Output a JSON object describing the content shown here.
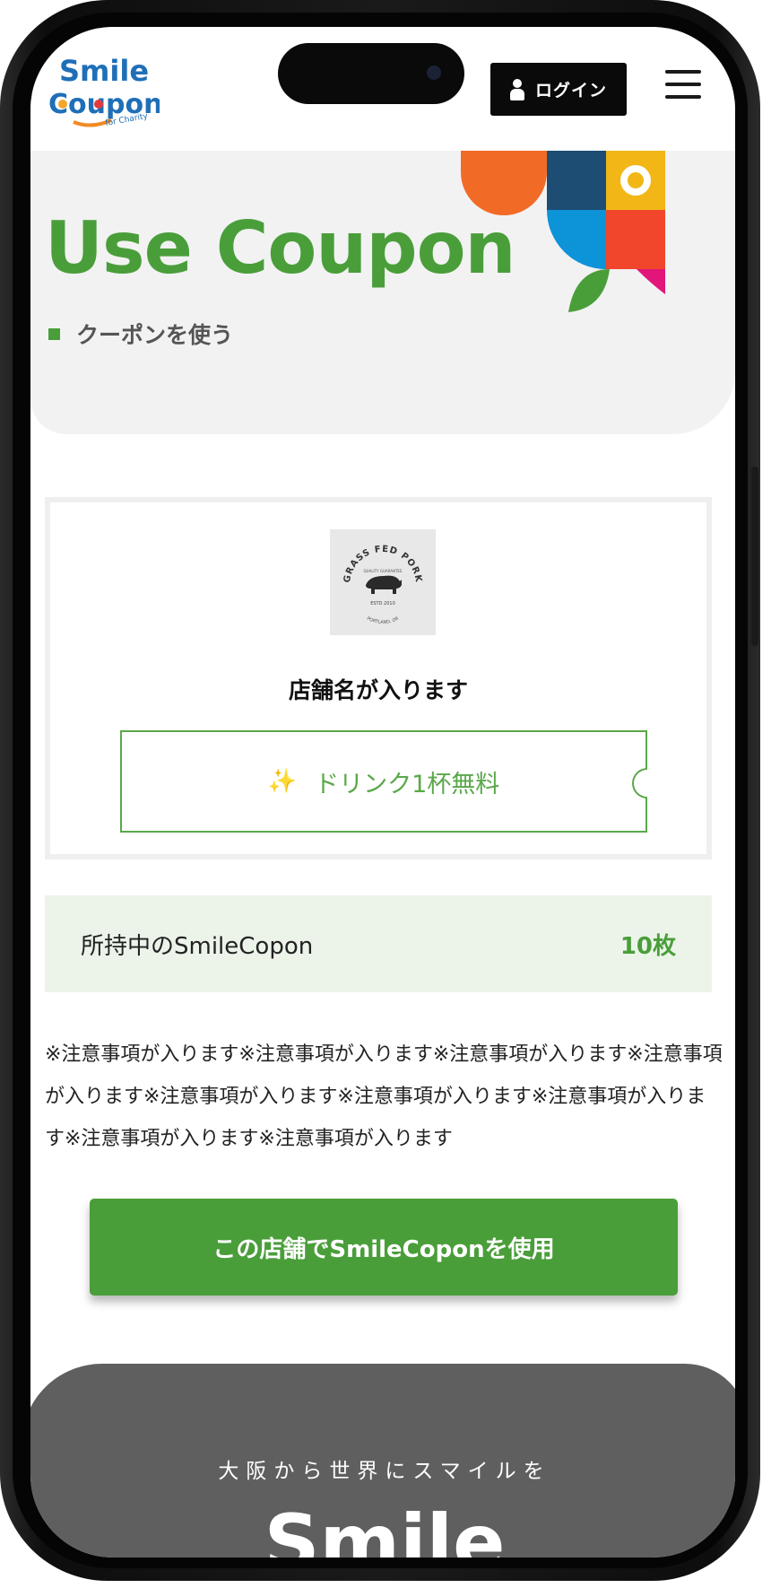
{
  "header": {
    "logo_text_top": "Smile",
    "logo_text_bottom": "Coupon",
    "logo_tagline": "for Charity",
    "login_label": "ログイン",
    "menu_icon": "hamburger-menu-icon"
  },
  "hero": {
    "title": "Use Coupon",
    "subtitle": "クーポンを使う"
  },
  "coupon_card": {
    "shop_logo": {
      "line1": "GRASS FED PORK",
      "line2": "QUALITY GUARANTEE",
      "line3": "ESTD 2010",
      "line4": "PORTLAND, OR"
    },
    "shop_name": "店舗名が入ります",
    "coupon_text": "ドリンク1杯無料",
    "coupon_icon": "sparkle-icon"
  },
  "balance": {
    "label": "所持中のSmileCopon",
    "value": "10枚"
  },
  "notes": "※注意事項が入ります※注意事項が入ります※注意事項が入ります※注意事項が入ります※注意事項が入ります※注意事項が入ります※注意事項が入ります※注意事項が入ります※注意事項が入ります",
  "use_button_label": "この店舗でSmileCoponを使用",
  "footer": {
    "tagline": "大阪から世界にスマイルを",
    "logo_text": "Smile"
  },
  "colors": {
    "brand_green": "#4a9e3a",
    "balance_bg": "#ecf4ea",
    "footer_bg": "#5f5f5f",
    "hero_bg": "#f2f2f2"
  }
}
